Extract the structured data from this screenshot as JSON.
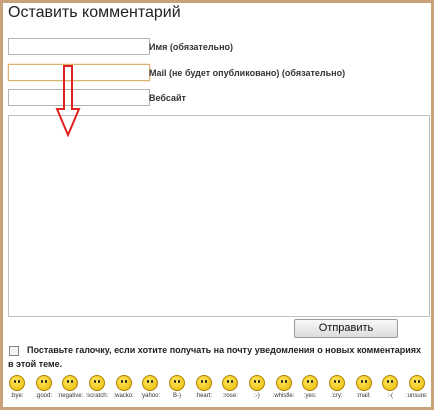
{
  "form": {
    "title": "Оставить комментарий",
    "name_label": "Имя (обязательно)",
    "mail_label": "Mail (не будет опубликовано) (обязательно)",
    "website_label": "Вебсайт",
    "name_value": "",
    "mail_value": "",
    "website_value": "",
    "comment_value": "",
    "submit_label": "Отправить",
    "notify_label": "Поставьте галочку, если хотите получать на почту уведомления о новых комментариях в этой теме."
  },
  "colors": {
    "frame_border": "#c8a27a",
    "arrow": "#e02020"
  },
  "smilies": [
    {
      "code": ":bye:",
      "icon": "bye-smiley-icon"
    },
    {
      "code": ":good:",
      "icon": "good-smiley-icon"
    },
    {
      "code": ":negative:",
      "icon": "negative-smiley-icon"
    },
    {
      "code": ":scratch:",
      "icon": "scratch-smiley-icon"
    },
    {
      "code": ":wacko:",
      "icon": "wacko-smiley-icon"
    },
    {
      "code": ":yahoo:",
      "icon": "yahoo-smiley-icon"
    },
    {
      "code": "B-)",
      "icon": "cool-smiley-icon"
    },
    {
      "code": ":heart:",
      "icon": "heart-smiley-icon"
    },
    {
      "code": ":rose:",
      "icon": "rose-smiley-icon"
    },
    {
      "code": ":-)",
      "icon": "smile-smiley-icon"
    },
    {
      "code": ":whistle:",
      "icon": "whistle-smiley-icon"
    },
    {
      "code": ":yes:",
      "icon": "yes-smiley-icon"
    },
    {
      "code": ":cry:",
      "icon": "cry-smiley-icon"
    },
    {
      "code": ":mail:",
      "icon": "mail-smiley-icon"
    },
    {
      "code": ":-(",
      "icon": "sad-smiley-icon"
    },
    {
      "code": ":unsure:",
      "icon": "unsure-smiley-icon"
    }
  ]
}
